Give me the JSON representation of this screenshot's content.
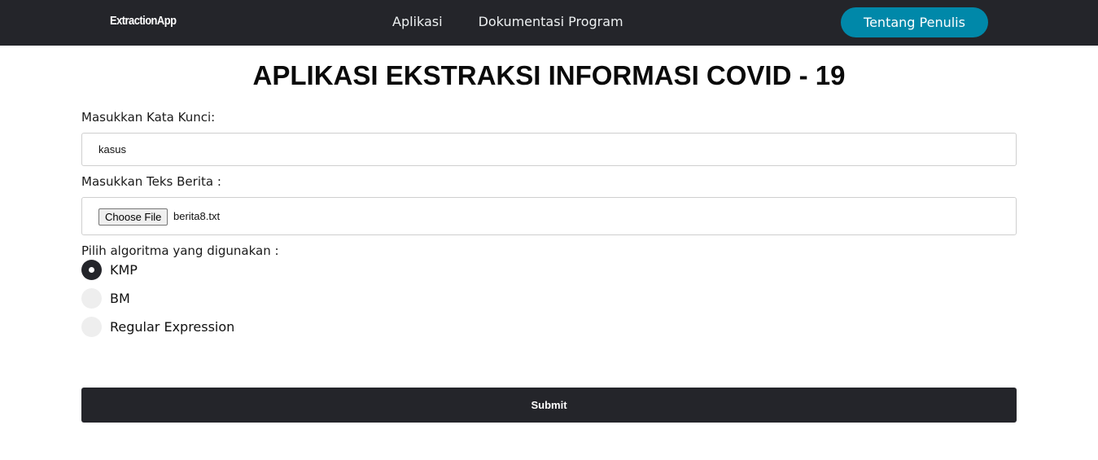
{
  "navbar": {
    "brand": "ExtractionApp",
    "links": [
      "Aplikasi",
      "Dokumentasi Program"
    ],
    "cta": "Tentang Penulis",
    "background": "#24252a",
    "cta_color": "#0088a9"
  },
  "page": {
    "title": "APLIKASI EKSTRAKSI INFORMASI COVID - 19"
  },
  "form": {
    "keyword_label": "Masukkan Kata Kunci:",
    "keyword_value": "kasus",
    "file_label": "Masukkan Teks Berita :",
    "file_button": "Choose File",
    "file_name": "berita8.txt",
    "algorithm_label": "Pilih algoritma yang digunakan :",
    "algorithms": [
      {
        "label": "KMP",
        "checked": true
      },
      {
        "label": "BM",
        "checked": false
      },
      {
        "label": "Regular Expression",
        "checked": false
      }
    ],
    "submit": "Submit"
  }
}
